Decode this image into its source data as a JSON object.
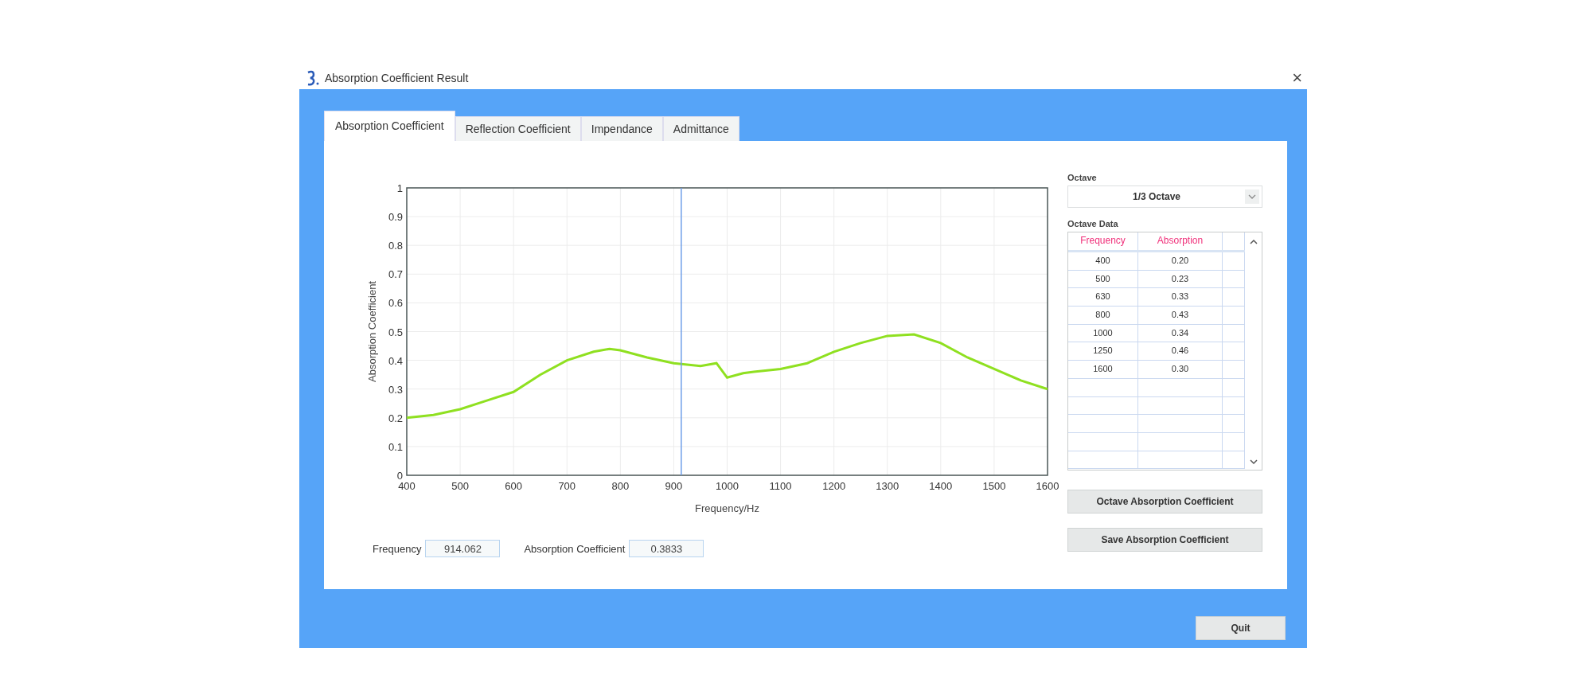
{
  "window": {
    "title": "Absorption Coefficient Result",
    "close": "×"
  },
  "tabs": [
    {
      "label": "Absorption Coefficient",
      "selected": true
    },
    {
      "label": "Reflection Coefficient",
      "selected": false
    },
    {
      "label": "Impendance",
      "selected": false
    },
    {
      "label": "Admittance",
      "selected": false
    }
  ],
  "chart": {
    "chart_data": {
      "type": "line",
      "xlabel": "Frequency/Hz",
      "ylabel": "Absorption Coefficient",
      "x": [
        400,
        450,
        500,
        550,
        600,
        650,
        700,
        750,
        780,
        800,
        850,
        900,
        950,
        980,
        1000,
        1030,
        1050,
        1100,
        1150,
        1200,
        1250,
        1300,
        1350,
        1400,
        1450,
        1500,
        1550,
        1600
      ],
      "series": [
        {
          "color": "#8fe020",
          "values": [
            0.2,
            0.21,
            0.23,
            0.26,
            0.29,
            0.35,
            0.4,
            0.43,
            0.44,
            0.435,
            0.41,
            0.39,
            0.38,
            0.39,
            0.34,
            0.355,
            0.36,
            0.37,
            0.39,
            0.43,
            0.46,
            0.485,
            0.49,
            0.46,
            0.41,
            0.37,
            0.33,
            0.3
          ]
        }
      ],
      "xlim": [
        400,
        1600
      ],
      "ylim": [
        0,
        1
      ],
      "xticks": [
        400,
        500,
        600,
        700,
        800,
        900,
        1000,
        1100,
        1200,
        1300,
        1400,
        1500,
        1600
      ],
      "yticks": [
        0,
        {
          "value": 0.1,
          "label": "0.1"
        },
        {
          "value": 0.2,
          "label": "0.2"
        },
        {
          "value": 0.3,
          "label": "0.3"
        },
        {
          "value": 0.4,
          "label": "0.4"
        },
        {
          "value": 0.5,
          "label": "0.5"
        },
        {
          "value": 0.6,
          "label": "0.6"
        },
        {
          "value": 0.7,
          "label": "0.7"
        },
        {
          "value": 0.8,
          "label": "0.8"
        },
        {
          "value": 0.9,
          "label": "0.9"
        },
        1
      ],
      "ref_lines": [
        {
          "axis": "x",
          "value": 914.062
        }
      ],
      "grid": true
    }
  },
  "readout": {
    "frequency_label": "Frequency",
    "frequency_value": "914.062",
    "coefficient_label": "Absorption Coefficient",
    "coefficient_value": "0.3833"
  },
  "octave": {
    "label": "Octave",
    "value": "1/3 Octave"
  },
  "octave_data": {
    "label": "Octave Data",
    "columns": [
      "Frequency",
      "Absorption"
    ],
    "rows": [
      [
        "400",
        "0.20"
      ],
      [
        "500",
        "0.23"
      ],
      [
        "630",
        "0.33"
      ],
      [
        "800",
        "0.43"
      ],
      [
        "1000",
        "0.34"
      ],
      [
        "1250",
        "0.46"
      ],
      [
        "1600",
        "0.30"
      ]
    ]
  },
  "buttons": [
    "Octave Absorption Coefficient",
    "Save Absorption Coefficient"
  ],
  "quit": "Quit"
}
